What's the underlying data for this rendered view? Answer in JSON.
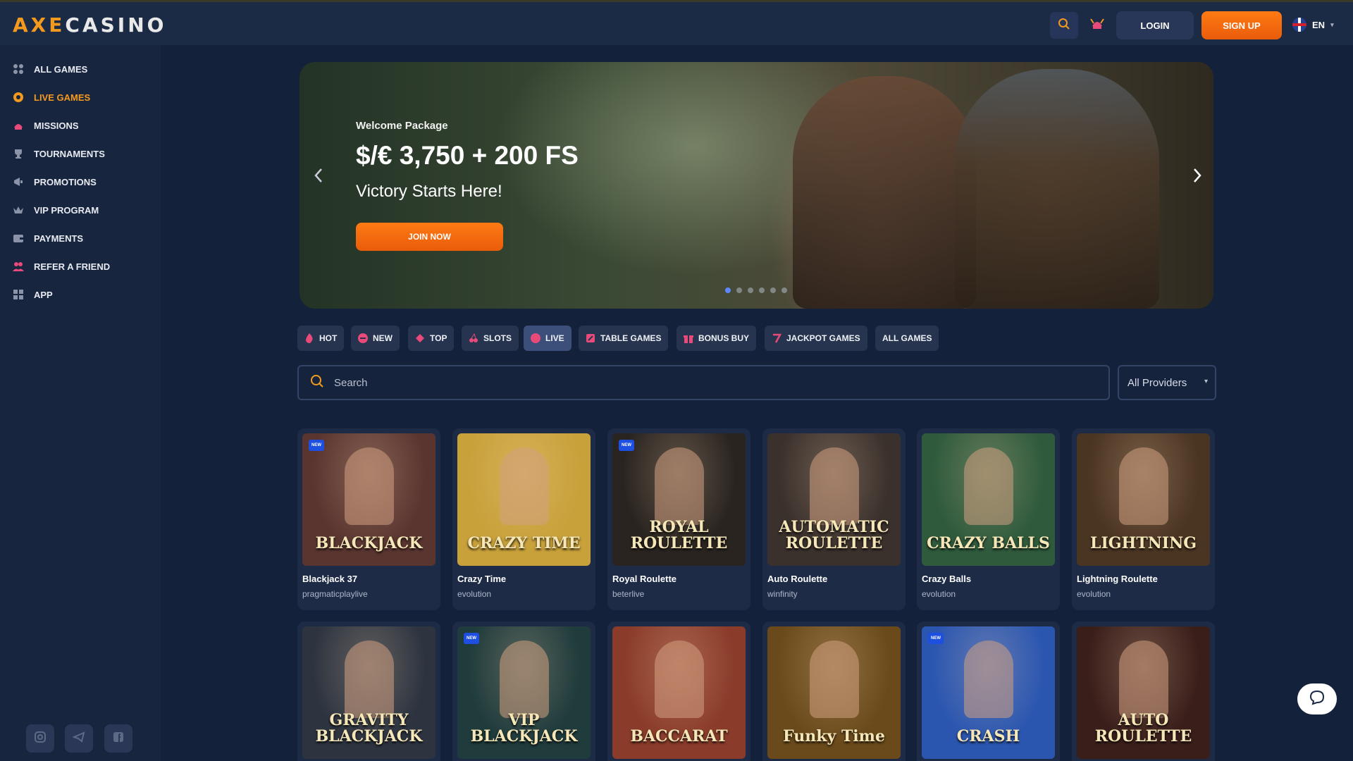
{
  "brand": {
    "logo_part1": "AXE",
    "logo_part2": "CASINO",
    "accent": "#f39a1e"
  },
  "header": {
    "search_icon": "search-icon",
    "missions_icon": "helmet-icon",
    "login": "LOGIN",
    "signup": "SIGN UP",
    "language": "EN"
  },
  "sidebar": {
    "items": [
      {
        "label": "ALL GAMES",
        "icon": "dice-icon",
        "active": false
      },
      {
        "label": "LIVE GAMES",
        "icon": "chip-icon",
        "active": true
      },
      {
        "label": "MISSIONS",
        "icon": "helmet-icon",
        "active": false
      },
      {
        "label": "TOURNAMENTS",
        "icon": "trophy-icon",
        "active": false
      },
      {
        "label": "PROMOTIONS",
        "icon": "megaphone-icon",
        "active": false
      },
      {
        "label": "VIP PROGRAM",
        "icon": "crown-icon",
        "active": false
      },
      {
        "label": "PAYMENTS",
        "icon": "wallet-icon",
        "active": false
      },
      {
        "label": "REFER A FRIEND",
        "icon": "friends-icon",
        "active": false
      },
      {
        "label": "APP",
        "icon": "app-grid-icon",
        "active": false
      }
    ],
    "social": [
      "instagram-icon",
      "telegram-icon",
      "facebook-icon"
    ]
  },
  "banner": {
    "kicker": "Welcome Package",
    "title": "$/€ 3,750 + 200 FS",
    "subtitle": "Victory Starts Here!",
    "cta": "JOIN NOW",
    "slides": 6,
    "active_slide": 1
  },
  "tabs": [
    {
      "label": "HOT",
      "icon": "flame-icon",
      "active": false
    },
    {
      "label": "NEW",
      "icon": "new-icon",
      "active": false
    },
    {
      "label": "TOP",
      "icon": "top-icon",
      "active": false
    },
    {
      "label": "SLOTS",
      "icon": "cherry-icon",
      "active": false
    },
    {
      "label": "LIVE",
      "icon": "live-icon",
      "active": true
    },
    {
      "label": "TABLE GAMES",
      "icon": "cards-icon",
      "active": false
    },
    {
      "label": "BONUS BUY",
      "icon": "gift-icon",
      "active": false
    },
    {
      "label": "JACKPOT GAMES",
      "icon": "seven-icon",
      "active": false
    },
    {
      "label": "ALL GAMES",
      "icon": "",
      "active": false
    }
  ],
  "search": {
    "placeholder": "Search",
    "providers": "All Providers"
  },
  "games": [
    {
      "name": "Blackjack 37",
      "provider": "pragmaticplaylive",
      "art": "BLACKJACK",
      "new": true,
      "bg": "#5a3530"
    },
    {
      "name": "Crazy Time",
      "provider": "evolution",
      "art": "CRAZY TIME",
      "new": false,
      "bg": "#c8a13a"
    },
    {
      "name": "Royal Roulette",
      "provider": "beterlive",
      "art": "ROYAL ROULETTE",
      "new": true,
      "bg": "#2a2420"
    },
    {
      "name": "Auto Roulette",
      "provider": "winfinity",
      "art": "AUTOMATIC ROULETTE",
      "new": false,
      "bg": "#3a302c"
    },
    {
      "name": "Crazy Balls",
      "provider": "evolution",
      "art": "CRAZY BALLS",
      "new": false,
      "bg": "#2f5a3c"
    },
    {
      "name": "Lightning Roulette",
      "provider": "evolution",
      "art": "LIGHTNING",
      "new": false,
      "bg": "#4a3422"
    },
    {
      "name": "",
      "provider": "",
      "art": "GRAVITY BLACKJACK",
      "new": false,
      "bg": "#2d3440"
    },
    {
      "name": "",
      "provider": "",
      "art": "VIP BLACKJACK",
      "new": true,
      "bg": "#1f3b3c"
    },
    {
      "name": "",
      "provider": "",
      "art": "BACCARAT",
      "new": false,
      "bg": "#8a3b2a"
    },
    {
      "name": "",
      "provider": "",
      "art": "Funky Time",
      "new": false,
      "bg": "#6a4a1a"
    },
    {
      "name": "",
      "provider": "",
      "art": "CRASH",
      "new": true,
      "bg": "#2b56b0"
    },
    {
      "name": "",
      "provider": "",
      "art": "AUTO ROULETTE",
      "new": false,
      "bg": "#3a1e1a"
    }
  ],
  "chat": {
    "icon": "chat-bubble-icon"
  }
}
